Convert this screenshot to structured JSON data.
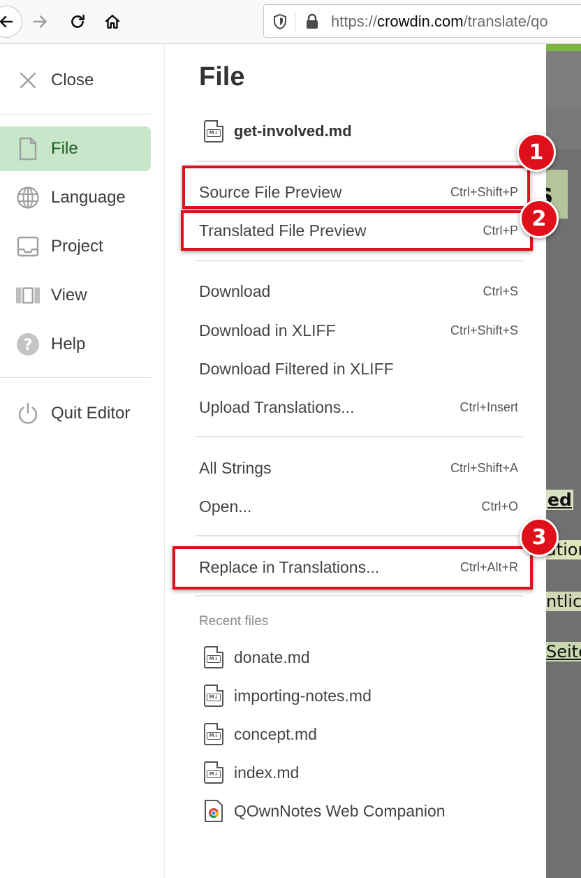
{
  "browser": {
    "url_prefix": "https://",
    "url_domain": "crowdin.com",
    "url_path": "/translate/qo"
  },
  "background_fragments": [
    "s",
    "ed",
    "ation",
    "ntlich",
    "Seite"
  ],
  "sidebar": {
    "close_label": "Close",
    "items": [
      {
        "label": "File",
        "icon": "file-icon"
      },
      {
        "label": "Language",
        "icon": "globe-icon"
      },
      {
        "label": "Project",
        "icon": "inbox-icon"
      },
      {
        "label": "View",
        "icon": "view-columns-icon"
      },
      {
        "label": "Help",
        "icon": "help-icon"
      }
    ],
    "quit_label": "Quit Editor"
  },
  "menu": {
    "title": "File",
    "current_file": "get-involved.md",
    "items": [
      {
        "label": "Source File Preview",
        "shortcut": "Ctrl+Shift+P"
      },
      {
        "label": "Translated File Preview",
        "shortcut": "Ctrl+P"
      },
      {
        "label": "Download",
        "shortcut": "Ctrl+S"
      },
      {
        "label": "Download in XLIFF",
        "shortcut": "Ctrl+Shift+S"
      },
      {
        "label": "Download Filtered in XLIFF",
        "shortcut": ""
      },
      {
        "label": "Upload Translations...",
        "shortcut": "Ctrl+Insert"
      },
      {
        "label": "All Strings",
        "shortcut": "Ctrl+Shift+A"
      },
      {
        "label": "Open...",
        "shortcut": "Ctrl+O"
      },
      {
        "label": "Replace in Translations...",
        "shortcut": "Ctrl+Alt+R"
      }
    ],
    "recent_heading": "Recent files",
    "recent_files": [
      {
        "name": "donate.md",
        "icon": "markdown-file-icon"
      },
      {
        "name": "importing-notes.md",
        "icon": "markdown-file-icon"
      },
      {
        "name": "concept.md",
        "icon": "markdown-file-icon"
      },
      {
        "name": "index.md",
        "icon": "markdown-file-icon"
      },
      {
        "name": "QOwnNotes Web Companion",
        "icon": "chrome-icon"
      }
    ]
  },
  "annotations": [
    "1",
    "2",
    "3"
  ],
  "colors": {
    "highlight": "#e0101a",
    "active_item_bg": "#c8e6c9",
    "active_item_text": "#1b5e20"
  }
}
